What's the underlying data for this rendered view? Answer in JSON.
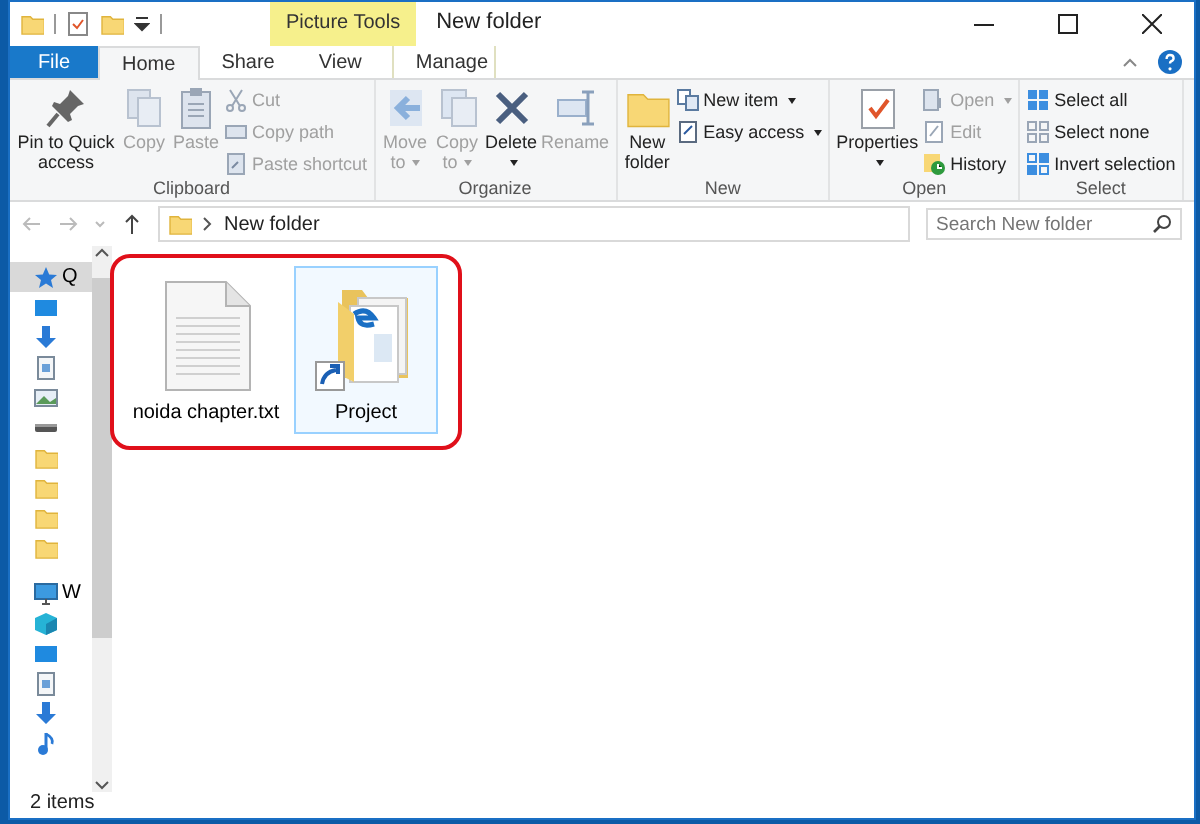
{
  "window": {
    "title": "New folder",
    "context_label": "Picture Tools"
  },
  "tabs": [
    {
      "label": "File",
      "kind": "file",
      "selected": false
    },
    {
      "label": "Home",
      "kind": "normal",
      "selected": true
    },
    {
      "label": "Share",
      "kind": "normal",
      "selected": false
    },
    {
      "label": "View",
      "kind": "normal",
      "selected": false
    },
    {
      "label": "Manage",
      "kind": "context",
      "selected": false
    }
  ],
  "ribbon": {
    "groups": [
      {
        "name": "Clipboard",
        "large": [
          {
            "label": "Pin to Quick access",
            "disabled": false,
            "has_menu": false
          },
          {
            "label": "Copy",
            "disabled": true,
            "has_menu": false
          },
          {
            "label": "Paste",
            "disabled": true,
            "has_menu": false
          }
        ],
        "small": [
          {
            "label": "Cut",
            "disabled": true,
            "has_menu": false
          },
          {
            "label": "Copy path",
            "disabled": true,
            "has_menu": false
          },
          {
            "label": "Paste shortcut",
            "disabled": true,
            "has_menu": false
          }
        ]
      },
      {
        "name": "Organize",
        "large": [
          {
            "label": "Move to",
            "disabled": true,
            "has_menu": true
          },
          {
            "label": "Copy to",
            "disabled": true,
            "has_menu": true
          },
          {
            "label": "Delete",
            "disabled": false,
            "has_menu": true
          },
          {
            "label": "Rename",
            "disabled": true,
            "has_menu": false
          }
        ]
      },
      {
        "name": "New",
        "large": [
          {
            "label": "New folder",
            "disabled": false,
            "has_menu": false
          }
        ],
        "small": [
          {
            "label": "New item",
            "disabled": false,
            "has_menu": true
          },
          {
            "label": "Easy access",
            "disabled": false,
            "has_menu": true
          }
        ]
      },
      {
        "name": "Open",
        "large": [
          {
            "label": "Properties",
            "disabled": false,
            "has_menu": true
          }
        ],
        "small": [
          {
            "label": "Open",
            "disabled": true,
            "has_menu": true
          },
          {
            "label": "Edit",
            "disabled": true,
            "has_menu": false
          },
          {
            "label": "History",
            "disabled": false,
            "has_menu": false
          }
        ]
      },
      {
        "name": "Select",
        "small": [
          {
            "label": "Select all",
            "disabled": false,
            "has_menu": false
          },
          {
            "label": "Select none",
            "disabled": false,
            "has_menu": false
          },
          {
            "label": "Invert selection",
            "disabled": false,
            "has_menu": false
          }
        ]
      }
    ]
  },
  "address": {
    "path": [
      "New folder"
    ],
    "search_placeholder": "Search New folder"
  },
  "nav_items": [
    {
      "kind": "quick-access",
      "label": "Q",
      "selected": true
    },
    {
      "kind": "desktop",
      "selected": false
    },
    {
      "kind": "download",
      "selected": false
    },
    {
      "kind": "document",
      "selected": false
    },
    {
      "kind": "pictures",
      "selected": false
    },
    {
      "kind": "drive",
      "selected": false
    },
    {
      "kind": "folder",
      "selected": false
    },
    {
      "kind": "folder",
      "selected": false
    },
    {
      "kind": "folder",
      "selected": false
    },
    {
      "kind": "folder",
      "selected": false
    },
    {
      "kind": "computer",
      "label": "W",
      "selected": false
    },
    {
      "kind": "objects",
      "selected": false
    },
    {
      "kind": "desktop",
      "selected": false
    },
    {
      "kind": "document",
      "selected": false
    },
    {
      "kind": "download",
      "selected": false
    },
    {
      "kind": "music",
      "selected": false
    }
  ],
  "files": [
    {
      "name": "noida chapter.txt",
      "kind": "text-document",
      "selected": false
    },
    {
      "name": "Project",
      "kind": "folder-shortcut",
      "selected": true
    }
  ],
  "status_bar": {
    "item_count": "2 items"
  }
}
